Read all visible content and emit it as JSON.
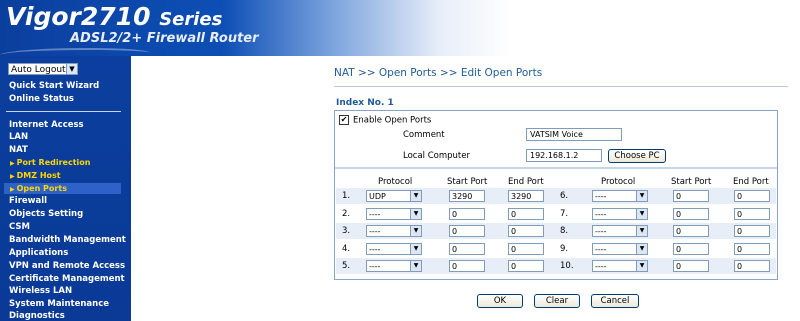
{
  "header": {
    "logo_title": "Vigor2710",
    "logo_series": "Series",
    "logo_subtitle": "ADSL2/2+ Firewall Router"
  },
  "sidebar": {
    "auto_logout": "Auto Logout",
    "items": [
      {
        "label": "Quick Start Wizard"
      },
      {
        "label": "Online Status"
      },
      {
        "label": "Internet Access"
      },
      {
        "label": "LAN"
      },
      {
        "label": "NAT"
      },
      {
        "label": "Port Redirection"
      },
      {
        "label": "DMZ Host"
      },
      {
        "label": "Open Ports"
      },
      {
        "label": "Firewall"
      },
      {
        "label": "Objects Setting"
      },
      {
        "label": "CSM"
      },
      {
        "label": "Bandwidth Management"
      },
      {
        "label": "Applications"
      },
      {
        "label": "VPN and Remote Access"
      },
      {
        "label": "Certificate Management"
      },
      {
        "label": "Wireless LAN"
      },
      {
        "label": "System Maintenance"
      },
      {
        "label": "Diagnostics"
      }
    ]
  },
  "main": {
    "breadcrumb": "NAT >> Open Ports >> Edit Open Ports",
    "index_label": "Index No. 1",
    "enable_label": "Enable Open Ports",
    "enable_checked": "✔",
    "comment_label": "Comment",
    "comment_value": "VATSIM Voice",
    "local_computer_label": "Local Computer",
    "local_computer_value": "192.168.1.2",
    "choose_pc": "Choose PC",
    "headers": {
      "protocol": "Protocol",
      "start_port": "Start Port",
      "end_port": "End Port"
    },
    "rows": [
      {
        "num": "1.",
        "protocol": "UDP",
        "start": "3290",
        "end": "3290"
      },
      {
        "num": "2.",
        "protocol": "----",
        "start": "0",
        "end": "0"
      },
      {
        "num": "3.",
        "protocol": "----",
        "start": "0",
        "end": "0"
      },
      {
        "num": "4.",
        "protocol": "----",
        "start": "0",
        "end": "0"
      },
      {
        "num": "5.",
        "protocol": "----",
        "start": "0",
        "end": "0"
      },
      {
        "num": "6.",
        "protocol": "----",
        "start": "0",
        "end": "0"
      },
      {
        "num": "7.",
        "protocol": "----",
        "start": "0",
        "end": "0"
      },
      {
        "num": "8.",
        "protocol": "----",
        "start": "0",
        "end": "0"
      },
      {
        "num": "9.",
        "protocol": "----",
        "start": "0",
        "end": "0"
      },
      {
        "num": "10.",
        "protocol": "----",
        "start": "0",
        "end": "0"
      }
    ],
    "buttons": {
      "ok": "OK",
      "clear": "Clear",
      "cancel": "Cancel"
    }
  },
  "icons": {
    "dropdown": "chevron-down-icon",
    "submenu": "triangle-right-icon"
  },
  "colors": {
    "sidebar_bg": "#0a3a96",
    "submenu_text": "#ffd700",
    "breadcrumb_text": "#1f5c9a",
    "row_alt_bg": "#e8eef7"
  }
}
